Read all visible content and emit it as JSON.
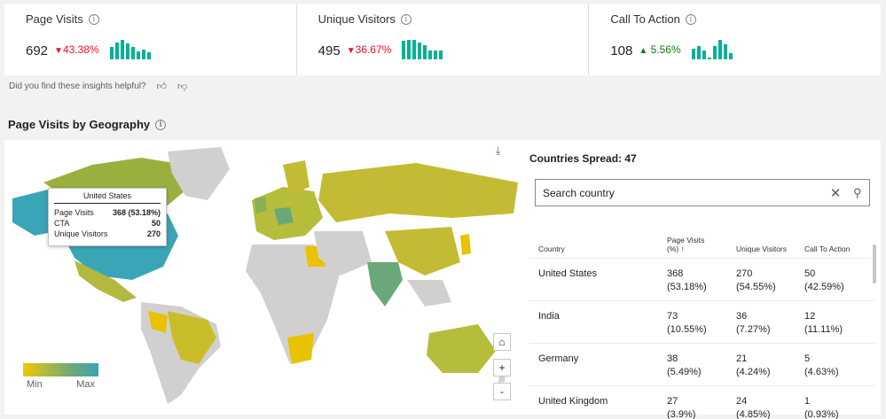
{
  "kpis": [
    {
      "title": "Page Visits",
      "value": "692",
      "change": "43.38%",
      "direction": "down",
      "spark": [
        14,
        19,
        22,
        18,
        14,
        9,
        11,
        8
      ]
    },
    {
      "title": "Unique Visitors",
      "value": "495",
      "change": "36.67%",
      "direction": "down",
      "spark": [
        14,
        15,
        15,
        13,
        11,
        7,
        7,
        7
      ]
    },
    {
      "title": "Call To Action",
      "value": "108",
      "change": "5.56%",
      "direction": "up",
      "spark": [
        10,
        12,
        8,
        2,
        12,
        18,
        14,
        6
      ]
    }
  ],
  "feedback": {
    "text": "Did you find these insights helpful?",
    "like_icon": "thumbs-up-icon",
    "dislike_icon": "thumbs-down-icon"
  },
  "section": {
    "title": "Page Visits by Geography"
  },
  "tooltip": {
    "country": "United States",
    "rows": [
      {
        "label": "Page Visits",
        "value": "368 (53.18%)"
      },
      {
        "label": "CTA",
        "value": "50"
      },
      {
        "label": "Unique Visitors",
        "value": "270"
      }
    ]
  },
  "legend": {
    "min": "Min",
    "max": "Max",
    "min_color": "#f0c800",
    "max_color": "#3ba5b8"
  },
  "map_controls": {
    "home": "⌂",
    "zoom_in": "+",
    "zoom_out": "-"
  },
  "spread": {
    "label": "Countries Spread: 47"
  },
  "search": {
    "placeholder": "Search country"
  },
  "table": {
    "headers": {
      "country": "Country",
      "page_visits": "Page Visits",
      "page_visits_unit": "(%)",
      "sort_icon": "↑",
      "unique": "Unique Visitors",
      "cta": "Call To Action"
    },
    "rows": [
      {
        "country": "United States",
        "pv": "368",
        "pv_pct": "(53.18%)",
        "uv": "270",
        "uv_pct": "(54.55%)",
        "cta": "50",
        "cta_pct": "(42.59%)"
      },
      {
        "country": "India",
        "pv": "73",
        "pv_pct": "(10.55%)",
        "uv": "36",
        "uv_pct": "(7.27%)",
        "cta": "12",
        "cta_pct": "(11.11%)"
      },
      {
        "country": "Germany",
        "pv": "38",
        "pv_pct": "(5.49%)",
        "uv": "21",
        "uv_pct": "(4.24%)",
        "cta": "5",
        "cta_pct": "(4.63%)"
      },
      {
        "country": "United Kingdom",
        "pv": "27",
        "pv_pct": "(3.9%)",
        "uv": "24",
        "uv_pct": "(4.85%)",
        "cta": "1",
        "cta_pct": "(0.93%)"
      }
    ]
  },
  "colors": {
    "accent_teal": "#00b294",
    "down_red": "#e81123",
    "up_green": "#107c10",
    "land_grey": "#d2d0ce"
  }
}
